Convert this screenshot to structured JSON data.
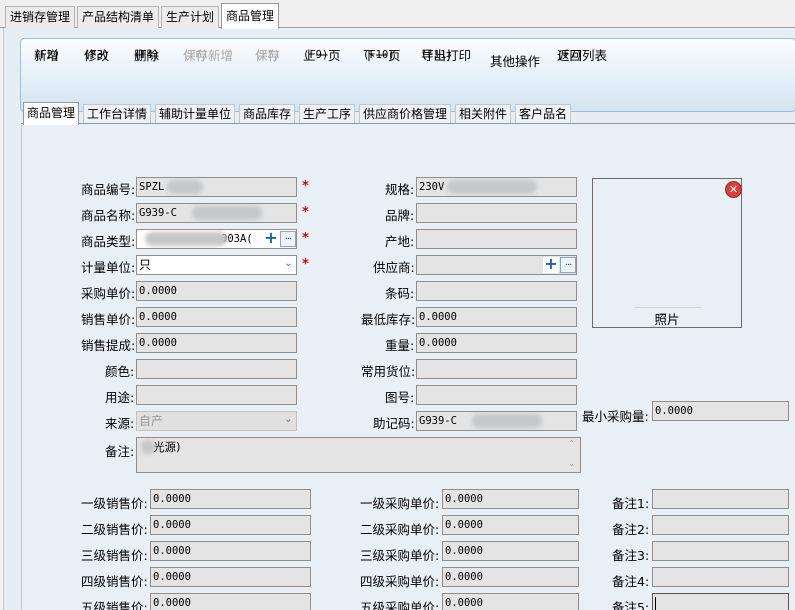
{
  "top_tabs": [
    "进销存管理",
    "产品结构清单",
    "生产计划",
    "商品管理"
  ],
  "toolbar": [
    {
      "label": "新增",
      "key": "(F2)",
      "enabled": true
    },
    {
      "label": "修改",
      "key": "(F3)",
      "enabled": true
    },
    {
      "label": "删除",
      "key": "(F4)",
      "enabled": true
    },
    {
      "label": "保存新增",
      "key": "(F6)",
      "enabled": false
    },
    {
      "label": "保存",
      "key": "(F5)",
      "enabled": false
    },
    {
      "label": "上一页",
      "key": "(F9)",
      "enabled": true
    },
    {
      "label": "下一页",
      "key": "(F10)",
      "enabled": true
    },
    {
      "label": "导出打印",
      "key": "(F11)",
      "enabled": true
    },
    {
      "label": "其他操作",
      "key": "",
      "enabled": true
    },
    {
      "label": "返回列表",
      "key": "(F7)",
      "enabled": true
    }
  ],
  "sub_tabs": [
    "商品管理",
    "工作台详情",
    "辅助计量单位",
    "商品库存",
    "生产工序",
    "供应商价格管理",
    "相关附件",
    "客户品名"
  ],
  "left": {
    "code_label": "商品编号:",
    "code_value": "SPZL",
    "name_label": "商品名称:",
    "name_value": "G939-C",
    "type_label": "商品类型:",
    "type_value": "003A(",
    "unit_label": "计量单位:",
    "unit_value": "只",
    "purchase_price_label": "采购单价:",
    "purchase_price_value": "0.0000",
    "sale_price_label": "销售单价:",
    "sale_price_value": "0.0000",
    "commission_label": "销售提成:",
    "commission_value": "0.0000",
    "color_label": "颜色:",
    "color_value": "",
    "usage_label": "用途:",
    "usage_value": "",
    "source_label": "来源:",
    "source_value": "自产",
    "remark_label": "备注:",
    "remark_value": "光源)"
  },
  "right": {
    "spec_label": "规格:",
    "spec_value": "230V",
    "brand_label": "品牌:",
    "brand_value": "",
    "origin_label": "产地:",
    "origin_value": "",
    "supplier_label": "供应商:",
    "supplier_value": "",
    "barcode_label": "条码:",
    "barcode_value": "",
    "min_stock_label": "最低库存:",
    "min_stock_value": "0.0000",
    "weight_label": "重量:",
    "weight_value": "0.0000",
    "location_label": "常用货位:",
    "location_value": "",
    "drawing_label": "图号:",
    "drawing_value": "",
    "mnemonic_label": "助记码:",
    "mnemonic_value": "G939-C"
  },
  "photo": {
    "caption": "照片"
  },
  "min_purchase": {
    "label": "最小采购量:",
    "value": "0.0000"
  },
  "sale_levels": [
    {
      "label": "一级销售价:",
      "value": "0.0000"
    },
    {
      "label": "二级销售价:",
      "value": "0.0000"
    },
    {
      "label": "三级销售价:",
      "value": "0.0000"
    },
    {
      "label": "四级销售价:",
      "value": "0.0000"
    },
    {
      "label": "五级销售价:",
      "value": "0.0000"
    }
  ],
  "purchase_levels": [
    {
      "label": "一级采购单价:",
      "value": "0.0000"
    },
    {
      "label": "二级采购单价:",
      "value": "0.0000"
    },
    {
      "label": "三级采购单价:",
      "value": "0.0000"
    },
    {
      "label": "四级采购单价:",
      "value": "0.0000"
    },
    {
      "label": "五级采购单价:",
      "value": "0.0000"
    }
  ],
  "notes": [
    {
      "label": "备注1:",
      "value": ""
    },
    {
      "label": "备注2:",
      "value": ""
    },
    {
      "label": "备注3:",
      "value": ""
    },
    {
      "label": "备注4:",
      "value": ""
    },
    {
      "label": "备注5:",
      "value": ""
    }
  ],
  "colors": {
    "accent": "#1f5fae",
    "required": "#dd0000",
    "panel": "#e8eff5"
  }
}
